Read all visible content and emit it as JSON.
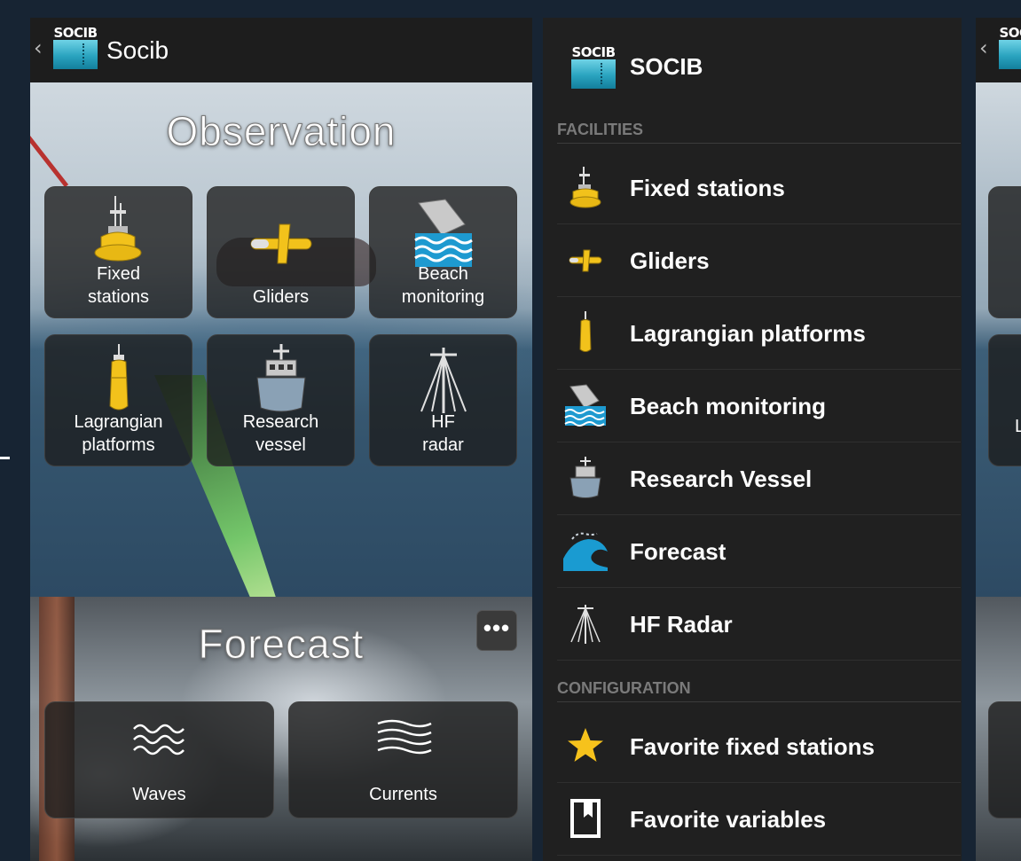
{
  "app": {
    "title": "Socib",
    "logo_text": "SOCIB"
  },
  "observation": {
    "title": "Observation",
    "tiles": [
      {
        "label": "Fixed\nstations",
        "icon": "buoy-icon"
      },
      {
        "label": "Gliders",
        "icon": "glider-icon"
      },
      {
        "label": "Beach\nmonitoring",
        "icon": "beach-camera-icon"
      },
      {
        "label": "Lagrangian\nplatforms",
        "icon": "drifter-icon"
      },
      {
        "label": "Research\nvessel",
        "icon": "vessel-icon"
      },
      {
        "label": "HF\nradar",
        "icon": "antenna-icon"
      }
    ]
  },
  "forecast": {
    "title": "Forecast",
    "tiles": [
      {
        "label": "Waves",
        "icon": "waves-icon"
      },
      {
        "label": "Currents",
        "icon": "currents-icon"
      }
    ],
    "overflow_label": "•••"
  },
  "drawer": {
    "title": "SOCIB",
    "sections": {
      "facilities": "FACILITIES",
      "configuration": "CONFIGURATION"
    },
    "items": [
      {
        "label": "Fixed stations",
        "icon": "buoy-icon"
      },
      {
        "label": "Gliders",
        "icon": "glider-icon"
      },
      {
        "label": "Lagrangian platforms",
        "icon": "drifter-icon"
      },
      {
        "label": "Beach monitoring",
        "icon": "beach-camera-icon"
      },
      {
        "label": "Research Vessel",
        "icon": "vessel-icon"
      },
      {
        "label": "Forecast",
        "icon": "wave-icon"
      },
      {
        "label": "HF Radar",
        "icon": "antenna-icon"
      }
    ],
    "config_items": [
      {
        "label": "Favorite fixed stations",
        "icon": "star-icon"
      },
      {
        "label": "Favorite variables",
        "icon": "bookmark-icon"
      }
    ]
  },
  "right_phone": {
    "partial_label": "L"
  },
  "colors": {
    "accent_yellow": "#f2c21b",
    "action_bar": "#1d1d1d",
    "drawer_bg": "#202020",
    "logo_cyan": "#2aa3bf"
  }
}
